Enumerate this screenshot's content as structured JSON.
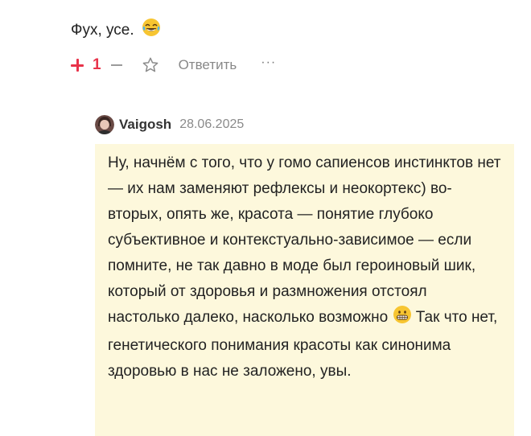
{
  "top_comment": {
    "text": "Фух, усе.",
    "emoji_icon": "laughing-tears-emoji"
  },
  "actions": {
    "plus_icon": "plus-icon",
    "score": "1",
    "minus_icon": "minus-icon",
    "star_icon": "star-icon",
    "reply_label": "Ответить",
    "more_label": "···"
  },
  "reply": {
    "author": "Vaigosh",
    "date": "28.06.2025",
    "text_before_emoji": "Ну, начнём с того, что у гомо сапиенсов инстинктов нет — их нам заменяют рефлексы и неокортекс) во-вторых, опять же, красота — понятие глубоко субъективное и контекстуально-зависимое — если помните, не так давно в моде был героиновый шик, который от здоровья и размножения отстоял настолько далеко, насколько возможно ",
    "emoji_icon": "grinning-emoji",
    "text_after_emoji": " Так что нет, генетического понимания красоты как синонима здоровью в нас не заложено, увы."
  },
  "colors": {
    "accent": "#e8334a",
    "reply_background": "#fdf8dc",
    "muted": "#8a8a8a"
  }
}
